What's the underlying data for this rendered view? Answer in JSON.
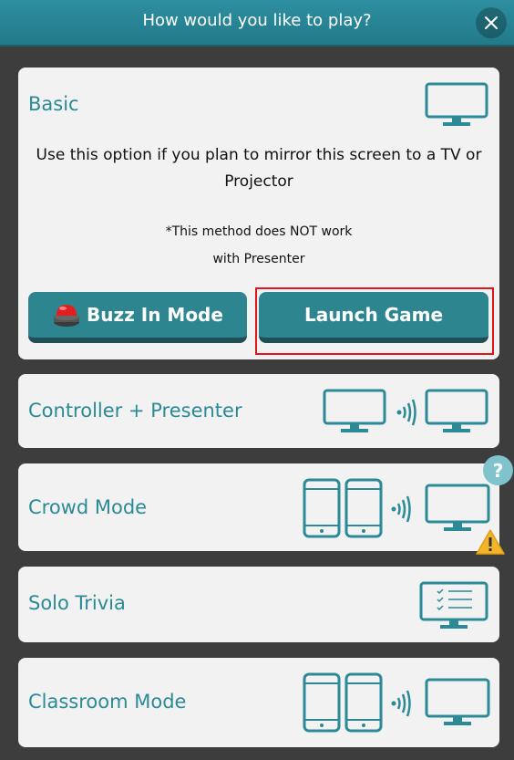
{
  "header": {
    "title": "How would you like to play?"
  },
  "basic": {
    "title": "Basic",
    "description": "Use this option if you plan to mirror this screen to a TV or Projector",
    "note_line1": "*This method does NOT work",
    "note_line2": "with Presenter",
    "buzz_button": "Buzz In Mode",
    "launch_button": "Launch Game"
  },
  "modes": [
    {
      "title": "Controller + Presenter"
    },
    {
      "title": "Crowd Mode"
    },
    {
      "title": "Solo Trivia"
    },
    {
      "title": "Classroom Mode"
    }
  ],
  "badges": {
    "help": "?"
  },
  "colors": {
    "accent": "#2b8a96",
    "header": "#2d8fa0",
    "highlight": "#e0161d"
  }
}
